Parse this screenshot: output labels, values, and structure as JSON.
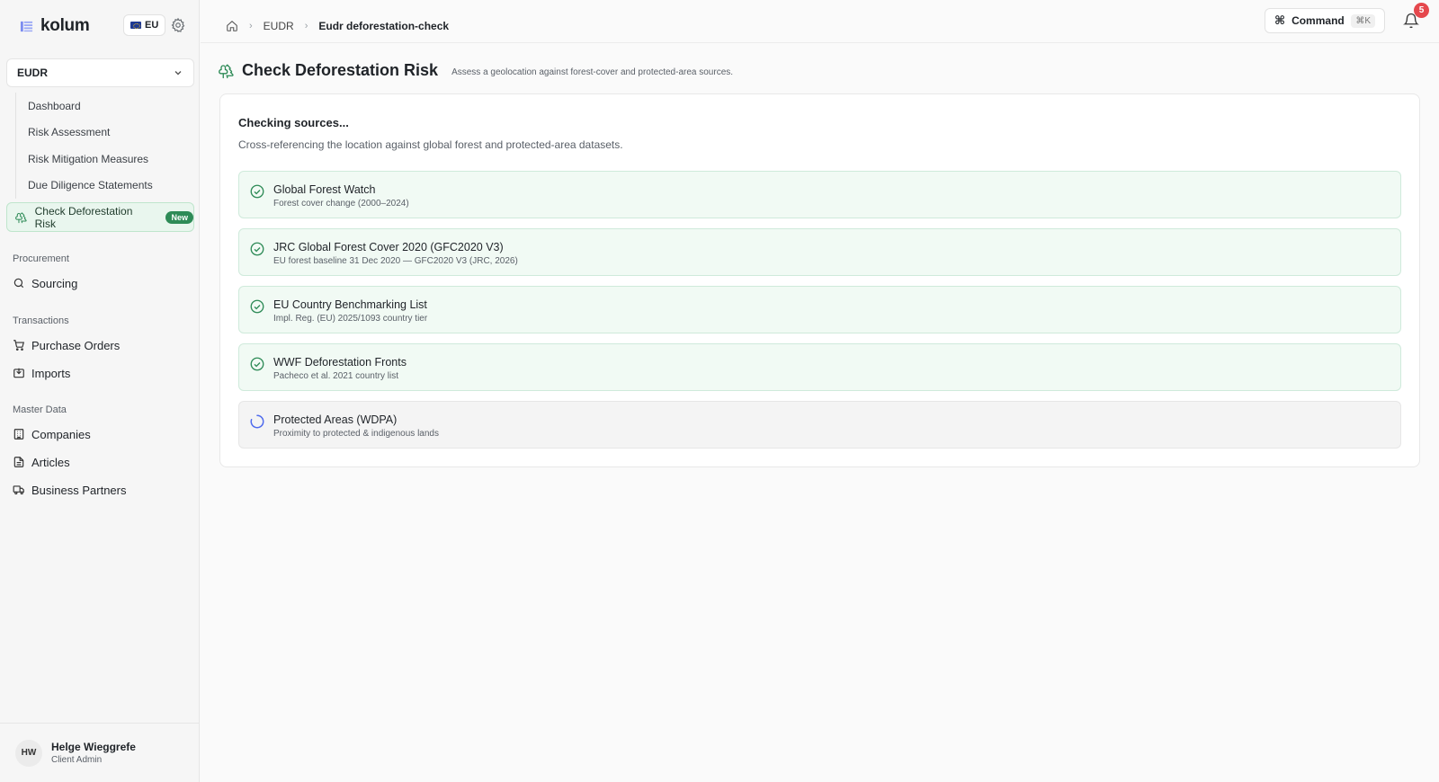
{
  "brand": {
    "name": "kolum"
  },
  "region": {
    "label": "EU"
  },
  "module_select": {
    "value": "EUDR"
  },
  "subnav": [
    {
      "label": "Dashboard"
    },
    {
      "label": "Risk Assessment"
    },
    {
      "label": "Risk Mitigation Measures"
    },
    {
      "label": "Due Diligence Statements"
    }
  ],
  "active_nav": {
    "label": "Check Deforestation Risk",
    "badge": "New"
  },
  "sections": {
    "procurement": "Procurement",
    "transactions": "Transactions",
    "master_data": "Master Data"
  },
  "nav": {
    "sourcing": "Sourcing",
    "purchase_orders": "Purchase Orders",
    "imports": "Imports",
    "companies": "Companies",
    "articles": "Articles",
    "business_partners": "Business Partners"
  },
  "user": {
    "initials": "HW",
    "name": "Helge Wieggrefe",
    "role": "Client Admin"
  },
  "breadcrumb": {
    "level1": "EUDR",
    "current": "Eudr deforestation-check"
  },
  "command": {
    "label": "Command",
    "shortcut": "⌘K"
  },
  "notifications": {
    "count": "5"
  },
  "page": {
    "title": "Check Deforestation Risk",
    "subtitle": "Assess a geolocation against forest-cover and protected-area sources."
  },
  "card": {
    "title": "Checking sources...",
    "description": "Cross-referencing the location against global forest and protected-area datasets."
  },
  "sources": [
    {
      "name": "Global Forest Watch",
      "detail": "Forest cover change (2000–2024)",
      "status": "done"
    },
    {
      "name": "JRC Global Forest Cover 2020 (GFC2020 V3)",
      "detail": "EU forest baseline 31 Dec 2020 — GFC2020 V3 (JRC, 2026)",
      "status": "done"
    },
    {
      "name": "EU Country Benchmarking List",
      "detail": "Impl. Reg. (EU) 2025/1093 country tier",
      "status": "done"
    },
    {
      "name": "WWF Deforestation Fronts",
      "detail": "Pacheco et al. 2021 country list",
      "status": "done"
    },
    {
      "name": "Protected Areas (WDPA)",
      "detail": "Proximity to protected & indigenous lands",
      "status": "loading"
    }
  ],
  "colors": {
    "accent": "#2e8b57",
    "success_bg": "#f1faf4",
    "loading": "#4f6bed",
    "badge_red": "#e5484d"
  }
}
